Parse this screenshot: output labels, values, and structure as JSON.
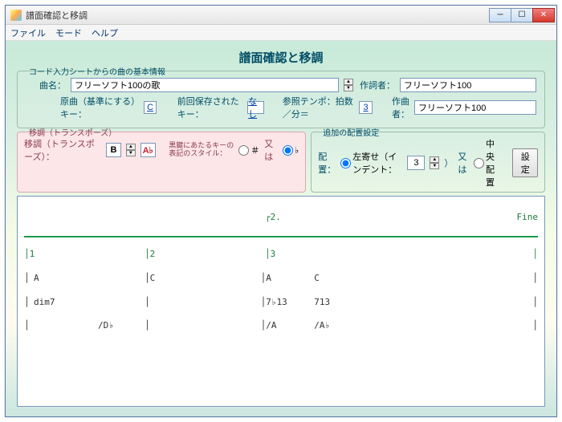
{
  "window": {
    "title": "譜面確認と移調"
  },
  "menu": {
    "file": "ファイル",
    "mode": "モード",
    "help": "ヘルプ"
  },
  "heading": "譜面確認と移調",
  "basic": {
    "legend": "コード入力シートからの曲の基本情報",
    "song_label": "曲名：",
    "song_value": "フリーソフト100の歌",
    "lyricist_label": "作詞者：",
    "lyricist_value": "フリーソフト100",
    "composer_label": "作曲者：",
    "composer_value": "フリーソフト100",
    "orig_key_label": "原曲（基準にする）キー：",
    "orig_key_value": "C",
    "saved_key_label": "前回保存されたキー：",
    "saved_key_value": "なし",
    "tempo_label": "参照テンポ：拍数／分＝",
    "tempo_value": "3"
  },
  "transpose": {
    "legend": "移調（トランスポーズ）",
    "label": "移調（トランスポーズ）：",
    "key1": "B",
    "key2": "A♭",
    "style_label": "黒鍵にあたるキーの\n表記のスタイル：",
    "sharp": "＃",
    "or": "又は",
    "flat": "♭"
  },
  "layout": {
    "legend": "追加の配置設定",
    "label": "配置：",
    "left": "左寄せ（インデント：",
    "indent": "3",
    "close": "）",
    "or": "又は",
    "center": "中央配置",
    "apply": "設定"
  },
  "score": {
    "top_mid": "┌2.",
    "top_right": "Fine",
    "bar1": "│1",
    "bar2": "│2",
    "bar3": "│3",
    "bar4": "│",
    "r1c1": "A",
    "r1c2": "C",
    "r1c3": "A",
    "r1c4": "C",
    "r2c1": "dim7",
    "r2c3": "7♭13",
    "r2c4": "713",
    "r3c1": "/D♭",
    "r3c3": "/A",
    "r3c4": "/A♭"
  }
}
